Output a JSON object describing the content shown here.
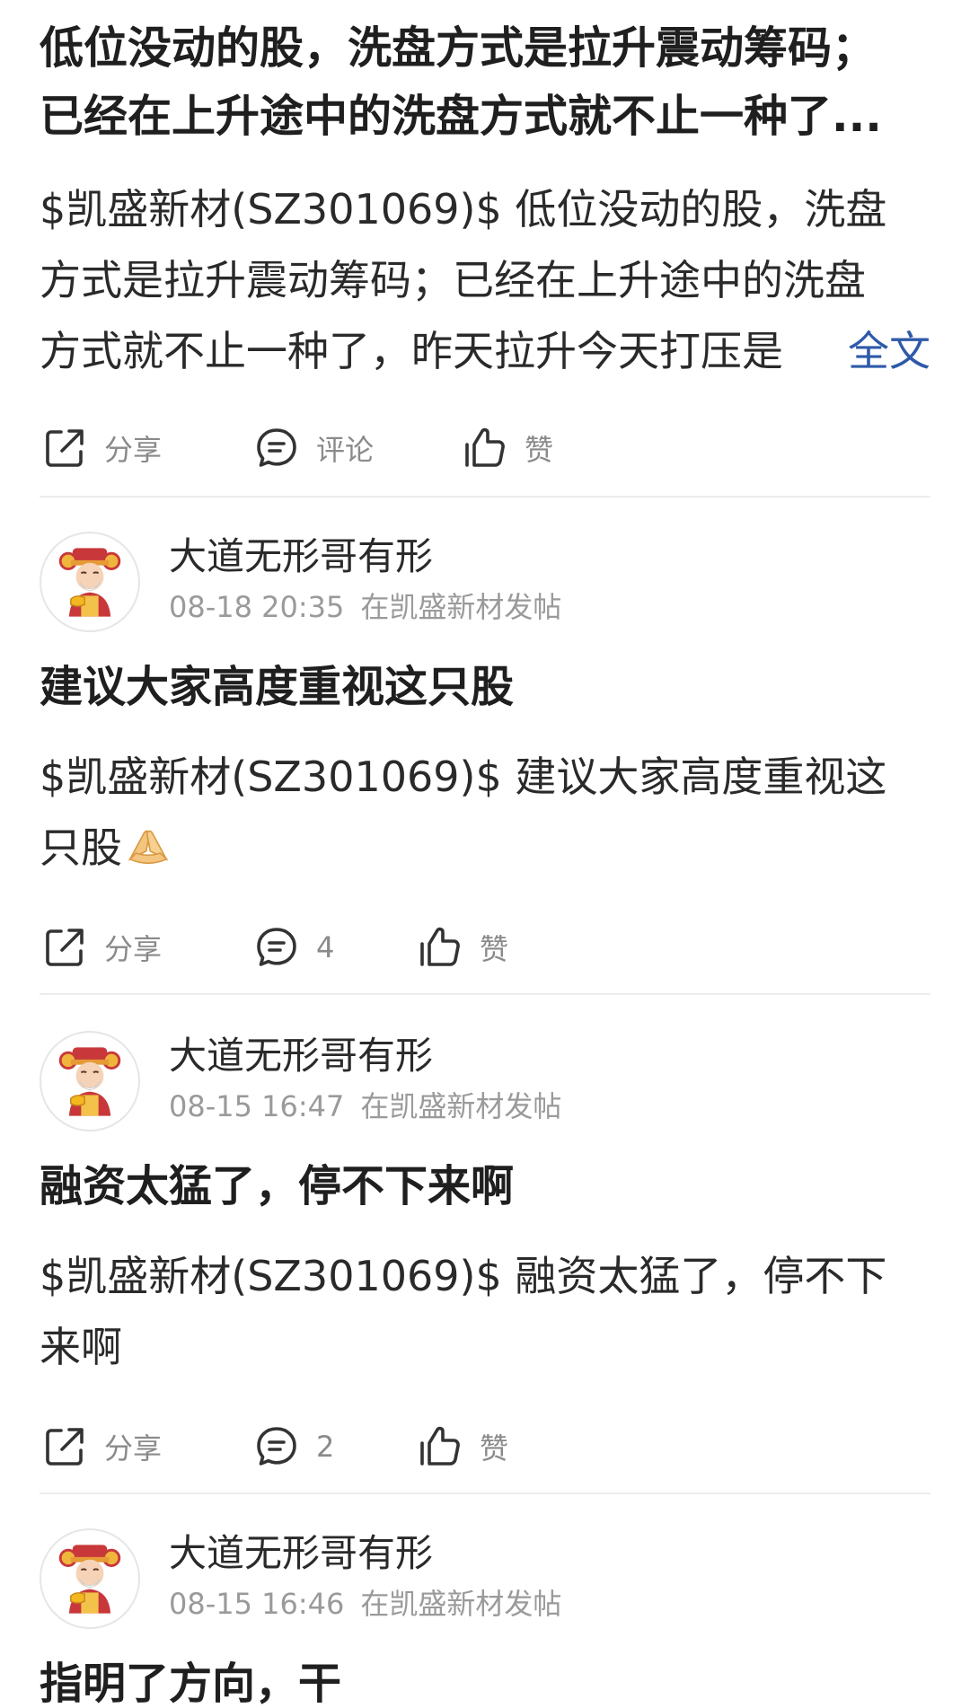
{
  "top_post": {
    "title_lines": [
      "低位没动的股，洗盘方式是拉升震动筹码；",
      "已经在上升途中的洗盘方式就不止一种了..."
    ],
    "body_lines": [
      "$凯盛新材(SZ301069)$ 低位没动的股，洗盘",
      "方式是拉升震动筹码；已经在上升途中的洗盘",
      "方式就不止一种了，昨天拉升今天打压是"
    ],
    "full_text_label": "全文",
    "actions": {
      "share": "分享",
      "comment": "评论",
      "like": "赞"
    }
  },
  "posts": [
    {
      "author": "大道无形哥有形",
      "time": "08-18 20:35",
      "where": "在凯盛新材发帖",
      "title": "建议大家高度重视这只股",
      "body_lines": [
        "$凯盛新材(SZ301069)$ 建议大家高度重视这",
        "只股"
      ],
      "actions": {
        "share": "分享",
        "comment": "4",
        "like": "赞"
      }
    },
    {
      "author": "大道无形哥有形",
      "time": "08-15 16:47",
      "where": "在凯盛新材发帖",
      "title": "融资太猛了，停不下来啊",
      "body_lines": [
        "$凯盛新材(SZ301069)$ 融资太猛了，停不下",
        "来啊"
      ],
      "actions": {
        "share": "分享",
        "comment": "2",
        "like": "赞"
      }
    },
    {
      "author": "大道无形哥有形",
      "time": "08-15 16:46",
      "where": "在凯盛新材发帖",
      "title": "指明了方向，干"
    }
  ],
  "colors": {
    "link": "#2e5aa8",
    "meta": "#9a9a9a",
    "divider": "#ececec"
  }
}
